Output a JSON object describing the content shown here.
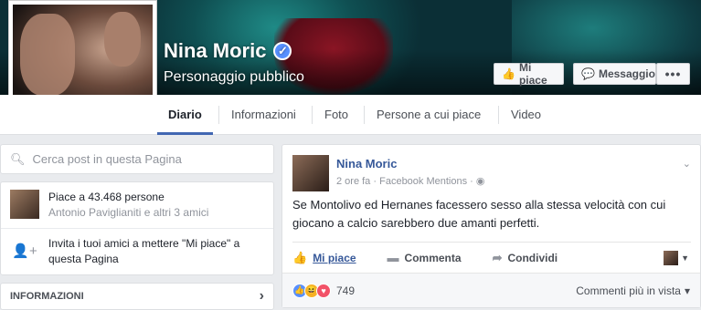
{
  "page": {
    "name": "Nina Moric",
    "category": "Personaggio pubblico",
    "verified_icon": "verified-check-icon"
  },
  "cover_buttons": {
    "like": "Mi piace",
    "message": "Messaggio",
    "more": "•••"
  },
  "tabs": [
    {
      "label": "Diario",
      "active": true
    },
    {
      "label": "Informazioni"
    },
    {
      "label": "Foto"
    },
    {
      "label": "Persone a cui piace"
    },
    {
      "label": "Video"
    }
  ],
  "search": {
    "placeholder": "Cerca post in questa Pagina"
  },
  "about": {
    "likes_main": "Piace a 43.468 persone",
    "likes_sub": "Antonio Paviglianiti e altri 3 amici",
    "invite_text": "Invita i tuoi amici a mettere \"Mi piace\" a questa Pagina",
    "info_title": "INFORMAZIONI",
    "info_chevron": "›"
  },
  "post": {
    "author": "Nina Moric",
    "time": "2 ore fa",
    "via": "Facebook Mentions",
    "separator": "·",
    "text": "Se Montolivo ed Hernanes facessero sesso alla stessa velocità con cui giocano a calcio sarebbero due amanti perfetti.",
    "actions": {
      "like": "Mi piace",
      "comment": "Commenta",
      "share": "Condividi"
    },
    "reaction_count": "749",
    "comments_sort": "Commenti più in vista",
    "sort_arrow": "▾"
  },
  "colors": {
    "fb_blue": "#4267b2",
    "link_blue": "#365899",
    "background": "#e9ebee"
  }
}
